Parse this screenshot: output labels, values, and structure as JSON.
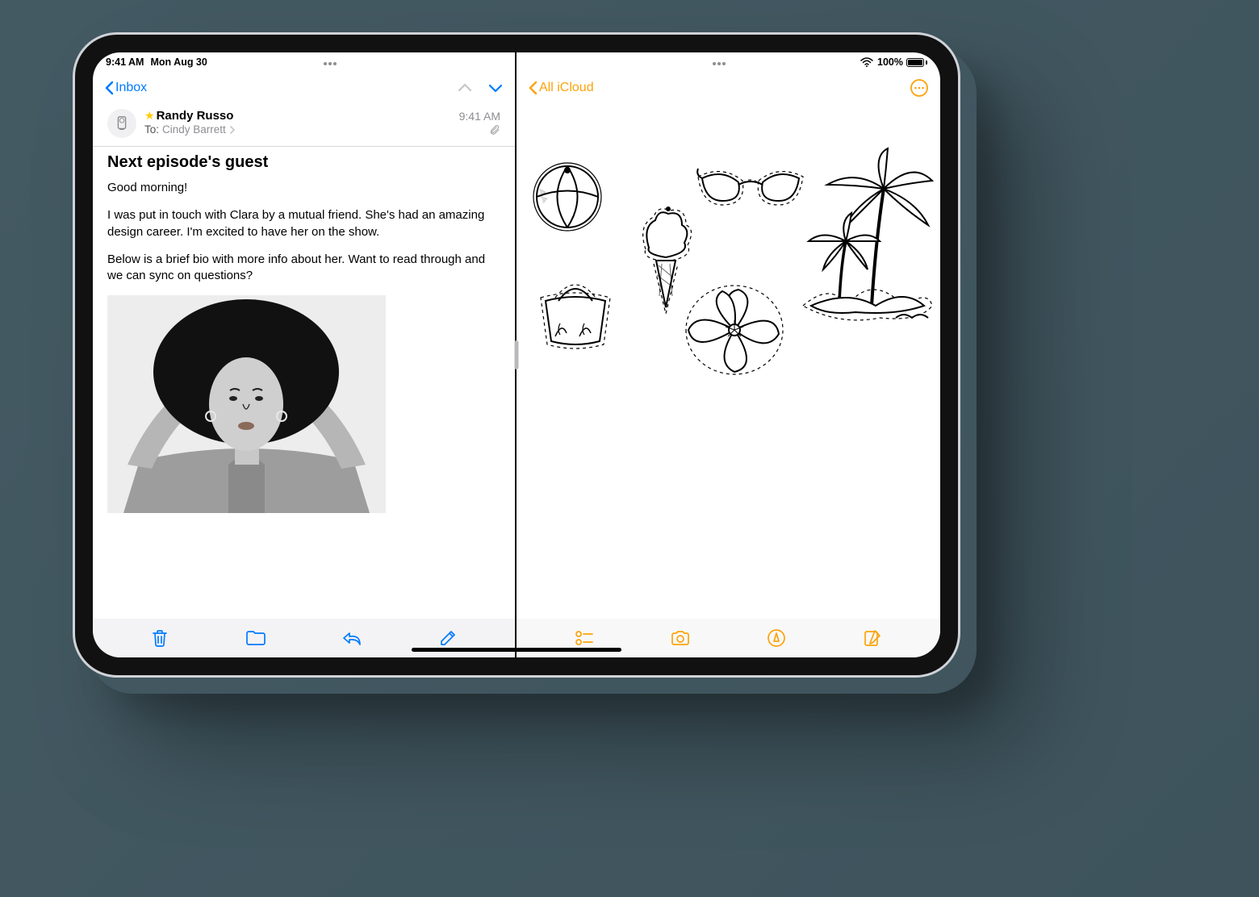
{
  "status": {
    "time": "9:41 AM",
    "date": "Mon Aug 30",
    "battery_percent": "100%"
  },
  "mail": {
    "back_label": "Inbox",
    "sender": "Randy Russo",
    "to_label": "To:",
    "recipient": "Cindy Barrett",
    "timestamp": "9:41 AM",
    "subject": "Next episode's guest",
    "paragraphs": [
      "Good morning!",
      "I was put in touch with Clara by a mutual friend. She's had an amazing design career. I'm excited to have her on the show.",
      "Below is a brief bio with more info about her. Want to read through and we can sync on questions?"
    ],
    "toolbar": [
      "trash",
      "folder",
      "reply",
      "compose"
    ]
  },
  "notes": {
    "back_label": "All iCloud",
    "sketches": [
      "beach-ball",
      "sunglasses",
      "ice-cream",
      "palm-trees",
      "beach-bag",
      "flower"
    ],
    "toolbar": [
      "checklist",
      "camera",
      "markup",
      "compose"
    ]
  },
  "colors": {
    "mail_accent": "#007aff",
    "notes_accent": "#fca30a"
  }
}
